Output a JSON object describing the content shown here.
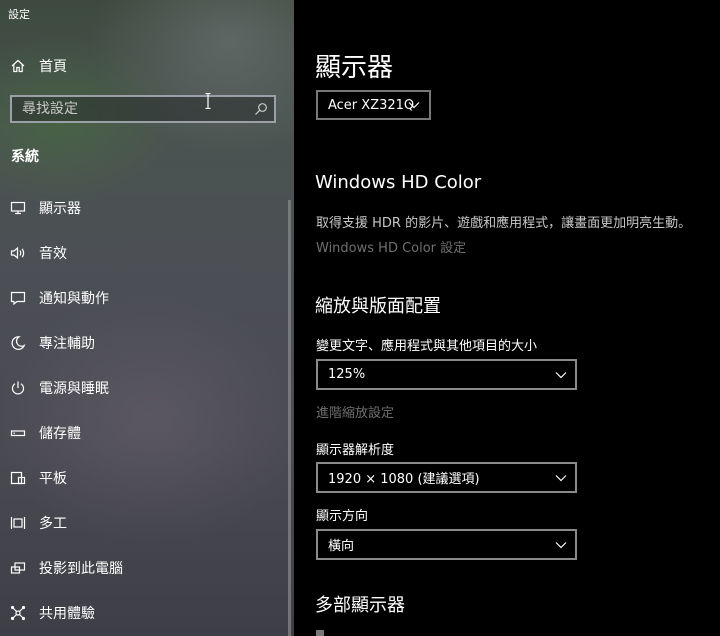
{
  "app": {
    "title": "設定"
  },
  "sidebar": {
    "home_label": "首頁",
    "search_placeholder": "尋找設定",
    "section_header": "系統",
    "items": [
      {
        "label": "顯示器",
        "icon": "monitor-icon"
      },
      {
        "label": "音效",
        "icon": "speaker-icon"
      },
      {
        "label": "通知與動作",
        "icon": "notification-icon"
      },
      {
        "label": "專注輔助",
        "icon": "moon-icon"
      },
      {
        "label": "電源與睡眠",
        "icon": "power-icon"
      },
      {
        "label": "儲存體",
        "icon": "storage-icon"
      },
      {
        "label": "平板",
        "icon": "tablet-icon"
      },
      {
        "label": "多工",
        "icon": "multitask-icon"
      },
      {
        "label": "投影到此電腦",
        "icon": "project-icon"
      },
      {
        "label": "共用體驗",
        "icon": "shared-experience-icon"
      }
    ]
  },
  "main": {
    "title": "顯示器",
    "monitor_select_value": "Acer XZ321Q",
    "hdr": {
      "heading": "Windows HD Color",
      "description": "取得支援 HDR 的影片、遊戲和應用程式，讓畫面更加明亮生動。",
      "settings_link": "Windows HD Color 設定"
    },
    "scale_layout": {
      "heading": "縮放與版面配置",
      "scale_label": "變更文字、應用程式與其他項目的大小",
      "scale_value": "125%",
      "advanced_link": "進階縮放設定",
      "resolution_label": "顯示器解析度",
      "resolution_value": "1920 × 1080 (建議選項)",
      "orientation_label": "顯示方向",
      "orientation_value": "橫向"
    },
    "multi_display": {
      "heading": "多部顯示器"
    }
  }
}
